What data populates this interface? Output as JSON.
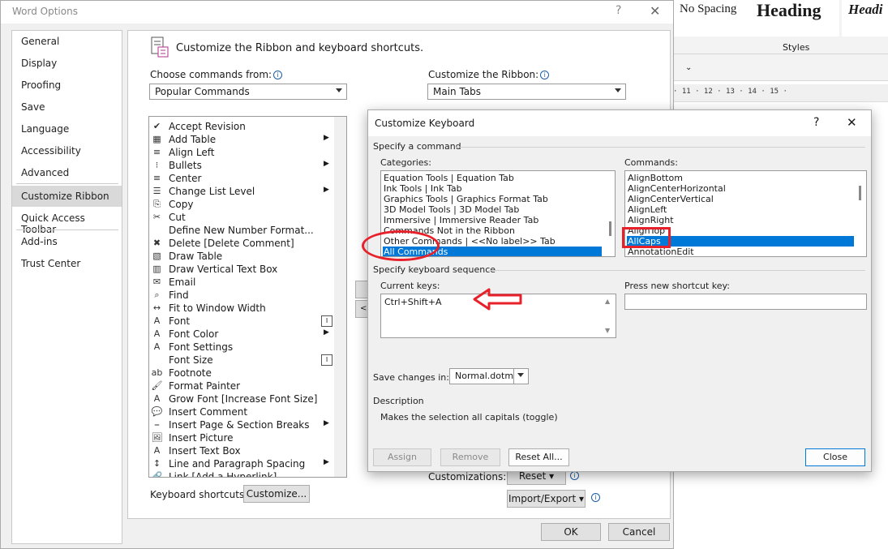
{
  "word_background": {
    "styles": [
      "No Spacing",
      "Heading",
      "Headi"
    ],
    "styles_group_label": "Styles",
    "ruler_text": "· 11 · 12 · 13 · 14 · 15 ·"
  },
  "word_options": {
    "title": "Word Options",
    "help_glyph": "?",
    "close_glyph": "✕",
    "nav": [
      "General",
      "Display",
      "Proofing",
      "Save",
      "Language",
      "Accessibility",
      "Advanced",
      "Customize Ribbon",
      "Quick Access Toolbar",
      "Add-ins",
      "Trust Center"
    ],
    "nav_selected": "Customize Ribbon",
    "header": "Customize the Ribbon and keyboard shortcuts.",
    "choose_label": "Choose commands from:",
    "choose_value": "Popular Commands",
    "ribbon_label": "Customize the Ribbon:",
    "ribbon_value": "Main Tabs",
    "commands": [
      {
        "label": "Accept Revision",
        "icon": "✔"
      },
      {
        "label": "Add Table",
        "icon": "▦",
        "sub": "▶"
      },
      {
        "label": "Align Left",
        "icon": "≡"
      },
      {
        "label": "Bullets",
        "icon": "⁝",
        "sub": "▶"
      },
      {
        "label": "Center",
        "icon": "≡"
      },
      {
        "label": "Change List Level",
        "icon": "☰",
        "sub": "▶"
      },
      {
        "label": "Copy",
        "icon": "⎘"
      },
      {
        "label": "Cut",
        "icon": "✂"
      },
      {
        "label": "Define New Number Format...",
        "icon": ""
      },
      {
        "label": "Delete [Delete Comment]",
        "icon": "✖"
      },
      {
        "label": "Draw Table",
        "icon": "▧"
      },
      {
        "label": "Draw Vertical Text Box",
        "icon": "▥"
      },
      {
        "label": "Email",
        "icon": "✉"
      },
      {
        "label": "Find",
        "icon": "⌕"
      },
      {
        "label": "Fit to Window Width",
        "icon": "↔"
      },
      {
        "label": "Font",
        "icon": "A",
        "box": "I"
      },
      {
        "label": "Font Color",
        "icon": "A",
        "sub": "▶"
      },
      {
        "label": "Font Settings",
        "icon": "A"
      },
      {
        "label": "Font Size",
        "icon": "",
        "box": "I"
      },
      {
        "label": "Footnote",
        "icon": "ab"
      },
      {
        "label": "Format Painter",
        "icon": "🖌"
      },
      {
        "label": "Grow Font [Increase Font Size]",
        "icon": "A"
      },
      {
        "label": "Insert Comment",
        "icon": "💬"
      },
      {
        "label": "Insert Page & Section Breaks",
        "icon": "⎯",
        "sub": "▶"
      },
      {
        "label": "Insert Picture",
        "icon": "🖼"
      },
      {
        "label": "Insert Text Box",
        "icon": "A"
      },
      {
        "label": "Line and Paragraph Spacing",
        "icon": "↕",
        "sub": "▶"
      },
      {
        "label": "Link [Add a Hyperlink]",
        "icon": "🔗"
      }
    ],
    "keyboard_shortcuts_label": "Keyboard shortcuts:",
    "customize_button": "Customize...",
    "customizations_label": "Customizations:",
    "reset_button": "Reset ▾",
    "import_export_button": "Import/Export ▾",
    "ok_button": "OK",
    "cancel_button": "Cancel"
  },
  "customize_keyboard": {
    "title": "Customize Keyboard",
    "help_glyph": "?",
    "close_glyph": "✕",
    "specify_command": "Specify a command",
    "categories_label": "Categories:",
    "categories": [
      "Equation Tools | Equation Tab",
      "Ink Tools | Ink Tab",
      "Graphics Tools | Graphics Format Tab",
      "3D Model Tools | 3D Model Tab",
      "Immersive | Immersive Reader Tab",
      "Commands Not in the Ribbon",
      "Other Commands | <<No label>> Tab",
      "All Commands"
    ],
    "categories_selected": "All Commands",
    "commands_label": "Commands:",
    "commands": [
      "AlignBottom",
      "AlignCenterHorizontal",
      "AlignCenterVertical",
      "AlignLeft",
      "AlignRight",
      "AlignTop",
      "AllCaps",
      "AnnotationEdit"
    ],
    "commands_selected": "AllCaps",
    "specify_sequence": "Specify keyboard sequence",
    "current_keys_label": "Current keys:",
    "current_keys": [
      "Ctrl+Shift+A"
    ],
    "press_new_label": "Press new shortcut key:",
    "press_new_value": "",
    "save_changes_label": "Save changes in:",
    "save_changes_value": "Normal.dotm",
    "description_label": "Description",
    "description": "Makes the selection all capitals (toggle)",
    "assign_button": "Assign",
    "remove_button": "Remove",
    "reset_all_button": "Reset All...",
    "close_button": "Close"
  },
  "colors": {
    "selection": "#0078d7",
    "annotation": "#e8202a"
  }
}
